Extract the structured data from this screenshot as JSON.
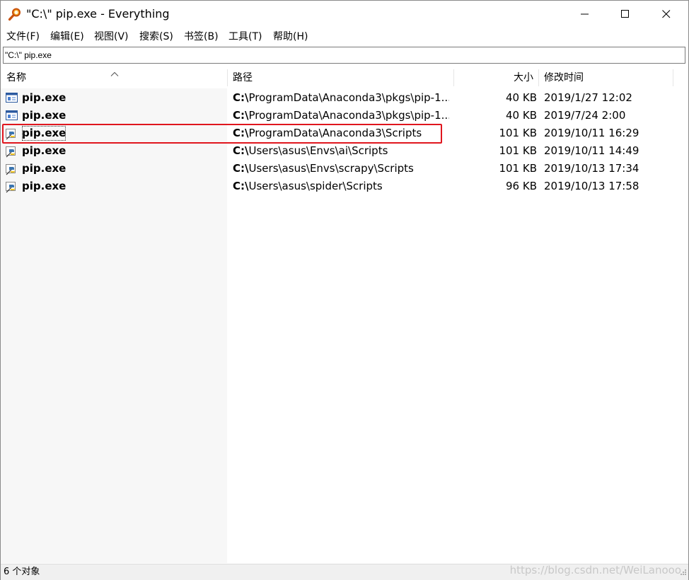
{
  "window": {
    "title": "\"C:\\\" pip.exe - Everything",
    "app_icon": "magnifier-icon"
  },
  "menu": [
    "文件(F)",
    "编辑(E)",
    "视图(V)",
    "搜索(S)",
    "书签(B)",
    "工具(T)",
    "帮助(H)"
  ],
  "search": {
    "value": "\"C:\\\" pip.exe"
  },
  "columns": {
    "name": "名称",
    "path": "路径",
    "size": "大小",
    "modified": "修改时间"
  },
  "rows": [
    {
      "icon": "exe-window-icon",
      "name": "pip.exe",
      "path_drive": "C:\\",
      "path_rest": "ProgramData\\Anaconda3\\pkgs\\pip-1...",
      "size": "40 KB",
      "modified": "2019/1/27 12:02"
    },
    {
      "icon": "exe-window-icon",
      "name": "pip.exe",
      "path_drive": "C:\\",
      "path_rest": "ProgramData\\Anaconda3\\pkgs\\pip-1...",
      "size": "40 KB",
      "modified": "2019/7/24 2:00"
    },
    {
      "icon": "python-exe-icon",
      "name": "pip.exe",
      "path_drive": "C:\\",
      "path_rest": "ProgramData\\Anaconda3\\Scripts",
      "size": "101 KB",
      "modified": "2019/10/11 16:29"
    },
    {
      "icon": "python-exe-icon",
      "name": "pip.exe",
      "path_drive": "C:\\",
      "path_rest": "Users\\asus\\Envs\\ai\\Scripts",
      "size": "101 KB",
      "modified": "2019/10/11 14:49"
    },
    {
      "icon": "python-exe-icon",
      "name": "pip.exe",
      "path_drive": "C:\\",
      "path_rest": "Users\\asus\\Envs\\scrapy\\Scripts",
      "size": "101 KB",
      "modified": "2019/10/13 17:34"
    },
    {
      "icon": "python-exe-icon",
      "name": "pip.exe",
      "path_drive": "C:\\",
      "path_rest": "Users\\asus\\spider\\Scripts",
      "size": "96 KB",
      "modified": "2019/10/13 17:58"
    }
  ],
  "status": {
    "text": "6 个对象",
    "watermark": "https://blog.csdn.net/WeiLanooo"
  },
  "colors": {
    "highlight": "#e0161e",
    "name_column_bg": "#f7f7f7"
  }
}
